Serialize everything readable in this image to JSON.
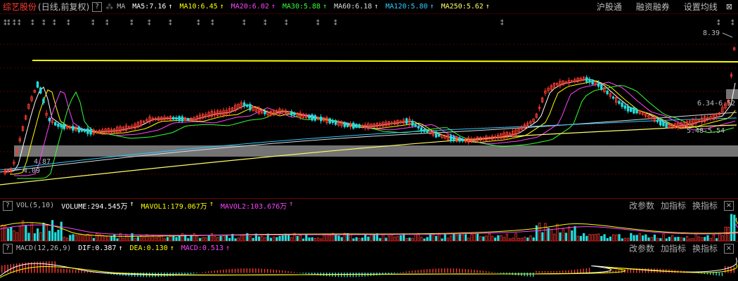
{
  "stock": {
    "name": "综艺股份",
    "period": "(日线,前复权)"
  },
  "ma_group_label": "MA",
  "ma_lines": [
    {
      "label": "MA5:7.16",
      "color": "#ffffff"
    },
    {
      "label": "MA10:6.45",
      "color": "#ffff00"
    },
    {
      "label": "MA20:6.02",
      "color": "#ff44ff"
    },
    {
      "label": "MA30:5.88",
      "color": "#33ff33"
    },
    {
      "label": "MA60:6.18",
      "color": "#dddddd"
    },
    {
      "label": "MA120:5.80",
      "color": "#33ccff"
    },
    {
      "label": "MA250:5.62",
      "color": "#ffff66"
    }
  ],
  "arrow_glyph": "↑",
  "help_glyph": "?",
  "close_glyph": "×",
  "top_buttons": [
    "沪股通",
    "融资融券",
    "设置均线"
  ],
  "price_labels": {
    "high": "8.39",
    "low": "4.09",
    "low_ma": "4.87",
    "range_upper": "6.34-6.52",
    "range_lower": "5.48-5.54"
  },
  "volume_panel": {
    "name": "VOL(5,10)",
    "items": [
      {
        "label": "VOLUME:294.545万",
        "color": "#ffffff"
      },
      {
        "label": "MAVOL1:179.067万",
        "color": "#ffff00"
      },
      {
        "label": "MAVOL2:103.676万",
        "color": "#ff44ff"
      }
    ],
    "buttons": [
      "改参数",
      "加指标",
      "换指标"
    ]
  },
  "macd_panel": {
    "name": "MACD(12,26,9)",
    "items": [
      {
        "label": "DIF:0.387",
        "color": "#ffffff"
      },
      {
        "label": "DEA:0.130",
        "color": "#ffff00"
      },
      {
        "label": "MACD:0.513",
        "color": "#ff44ff"
      }
    ],
    "buttons": [
      "改参数",
      "加指标",
      "换指标"
    ]
  },
  "colors": {
    "up": "#ff3b30",
    "down": "#22dddd",
    "grid": "#5a0000",
    "resistance": "#ffff00",
    "zone": "#888888"
  }
}
